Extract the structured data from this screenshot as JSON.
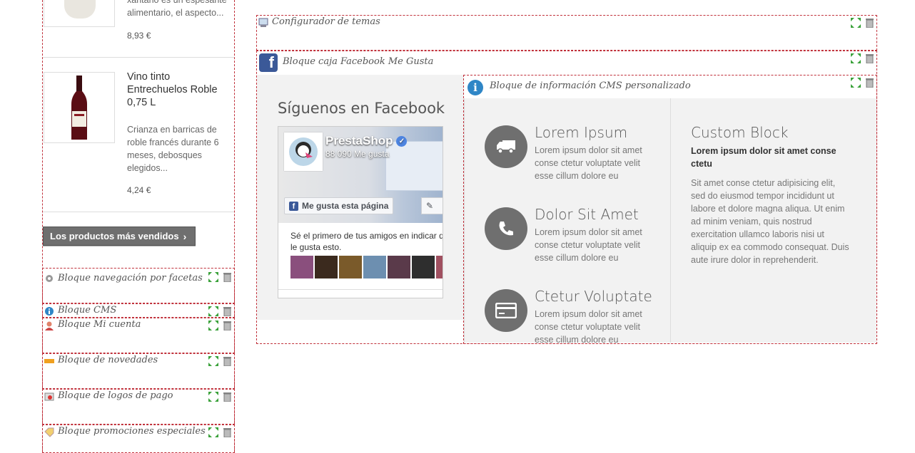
{
  "left_column": {
    "product1": {
      "desc": "xantano es un espesante alimentario, el aspecto...",
      "price": "8,93 €"
    },
    "product2": {
      "name": "Vino tinto Entrechuelos Roble 0,75 L",
      "desc": "Crianza en barricas de roble francés durante 6 meses, debosques elegidos...",
      "price": "4,24 €"
    },
    "bestsellers_button": "Los productos más vendidos",
    "modules": [
      {
        "label": "Bloque navegación por facetas",
        "icon": "gear-icon"
      },
      {
        "label": "Bloque CMS",
        "icon": "info-icon"
      },
      {
        "label": "Bloque Mi cuenta",
        "icon": "user-icon"
      },
      {
        "label": "Bloque de novedades",
        "icon": "new-badge-icon"
      },
      {
        "label": "Bloque de logos de pago",
        "icon": "payment-icon"
      },
      {
        "label": "Bloque promociones especiales",
        "icon": "tag-icon"
      }
    ]
  },
  "main": {
    "theme_configurator": "Configurador de temas",
    "facebook_module": "Bloque caja Facebook Me Gusta",
    "facebook": {
      "heading": "Síguenos en Facebook",
      "page_name": "PrestaShop",
      "likes": "88 090 Me gusta",
      "like_button": "Me gusta esta página",
      "friends_text": "Sé el primero de tus amigos en indicar que le gusta esto."
    },
    "cms_module": "Bloque de información CMS personalizado",
    "services": [
      {
        "title": "Lorem Ipsum",
        "text": "Lorem ipsum dolor sit amet conse ctetur voluptate velit esse cillum dolore eu",
        "icon": "truck-icon"
      },
      {
        "title": "Dolor Sit Amet",
        "text": "Lorem ipsum dolor sit amet conse ctetur voluptate velit esse cillum dolore eu",
        "icon": "phone-icon"
      },
      {
        "title": "Ctetur Voluptate",
        "text": "Lorem ipsum dolor sit amet conse ctetur voluptate velit esse cillum dolore eu",
        "icon": "credit-card-icon"
      }
    ],
    "custom_block": {
      "title": "Custom Block",
      "subtitle": "Lorem ipsum dolor sit amet conse ctetu",
      "text": "Sit amet conse ctetur adipisicing elit, sed do eiusmod tempor incididunt ut labore et dolore magna aliqua. Ut enim ad minim veniam, quis nostrud exercitation ullamco laboris nisi ut aliquip ex ea commodo consequat. Duis aute irure dolor in reprehenderit."
    }
  },
  "colors": {
    "dashed_border": "#c0303a",
    "move_icon": "#3aa13a",
    "bestsellers_bg": "#6f6f6f",
    "facebook_blue": "#3b5998",
    "info_blue": "#2f86c6"
  }
}
